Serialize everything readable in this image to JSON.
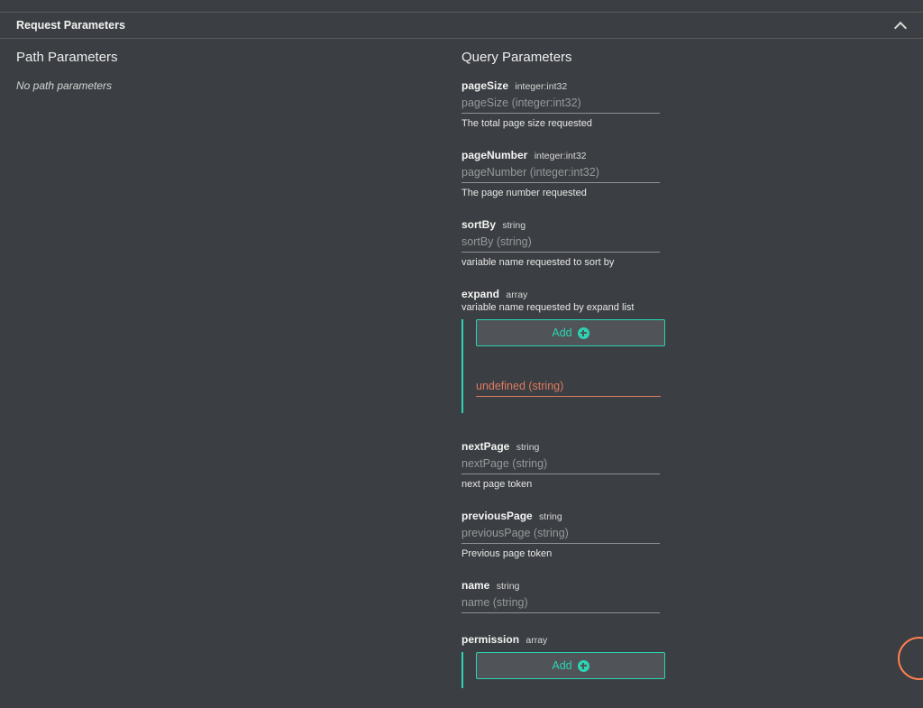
{
  "section": {
    "title": "Request Parameters"
  },
  "path": {
    "title": "Path Parameters",
    "empty_message": "No path parameters"
  },
  "query": {
    "title": "Query Parameters",
    "params": {
      "pageSize": {
        "name": "pageSize",
        "type": "integer:int32",
        "placeholder": "pageSize (integer:int32)",
        "desc": "The total page size requested"
      },
      "pageNumber": {
        "name": "pageNumber",
        "type": "integer:int32",
        "placeholder": "pageNumber (integer:int32)",
        "desc": "The page number requested"
      },
      "sortBy": {
        "name": "sortBy",
        "type": "string",
        "placeholder": "sortBy (string)",
        "desc": "variable name requested to sort by"
      },
      "expand": {
        "name": "expand",
        "type": "array",
        "desc": "variable name requested by expand list",
        "add_label": "Add",
        "item_placeholder": "undefined (string)"
      },
      "nextPage": {
        "name": "nextPage",
        "type": "string",
        "placeholder": "nextPage (string)",
        "desc": "next page token"
      },
      "previousPage": {
        "name": "previousPage",
        "type": "string",
        "placeholder": "previousPage (string)",
        "desc": "Previous page token"
      },
      "name": {
        "name": "name",
        "type": "string",
        "placeholder": "name (string)"
      },
      "permission": {
        "name": "permission",
        "type": "array",
        "add_label": "Add"
      }
    }
  }
}
